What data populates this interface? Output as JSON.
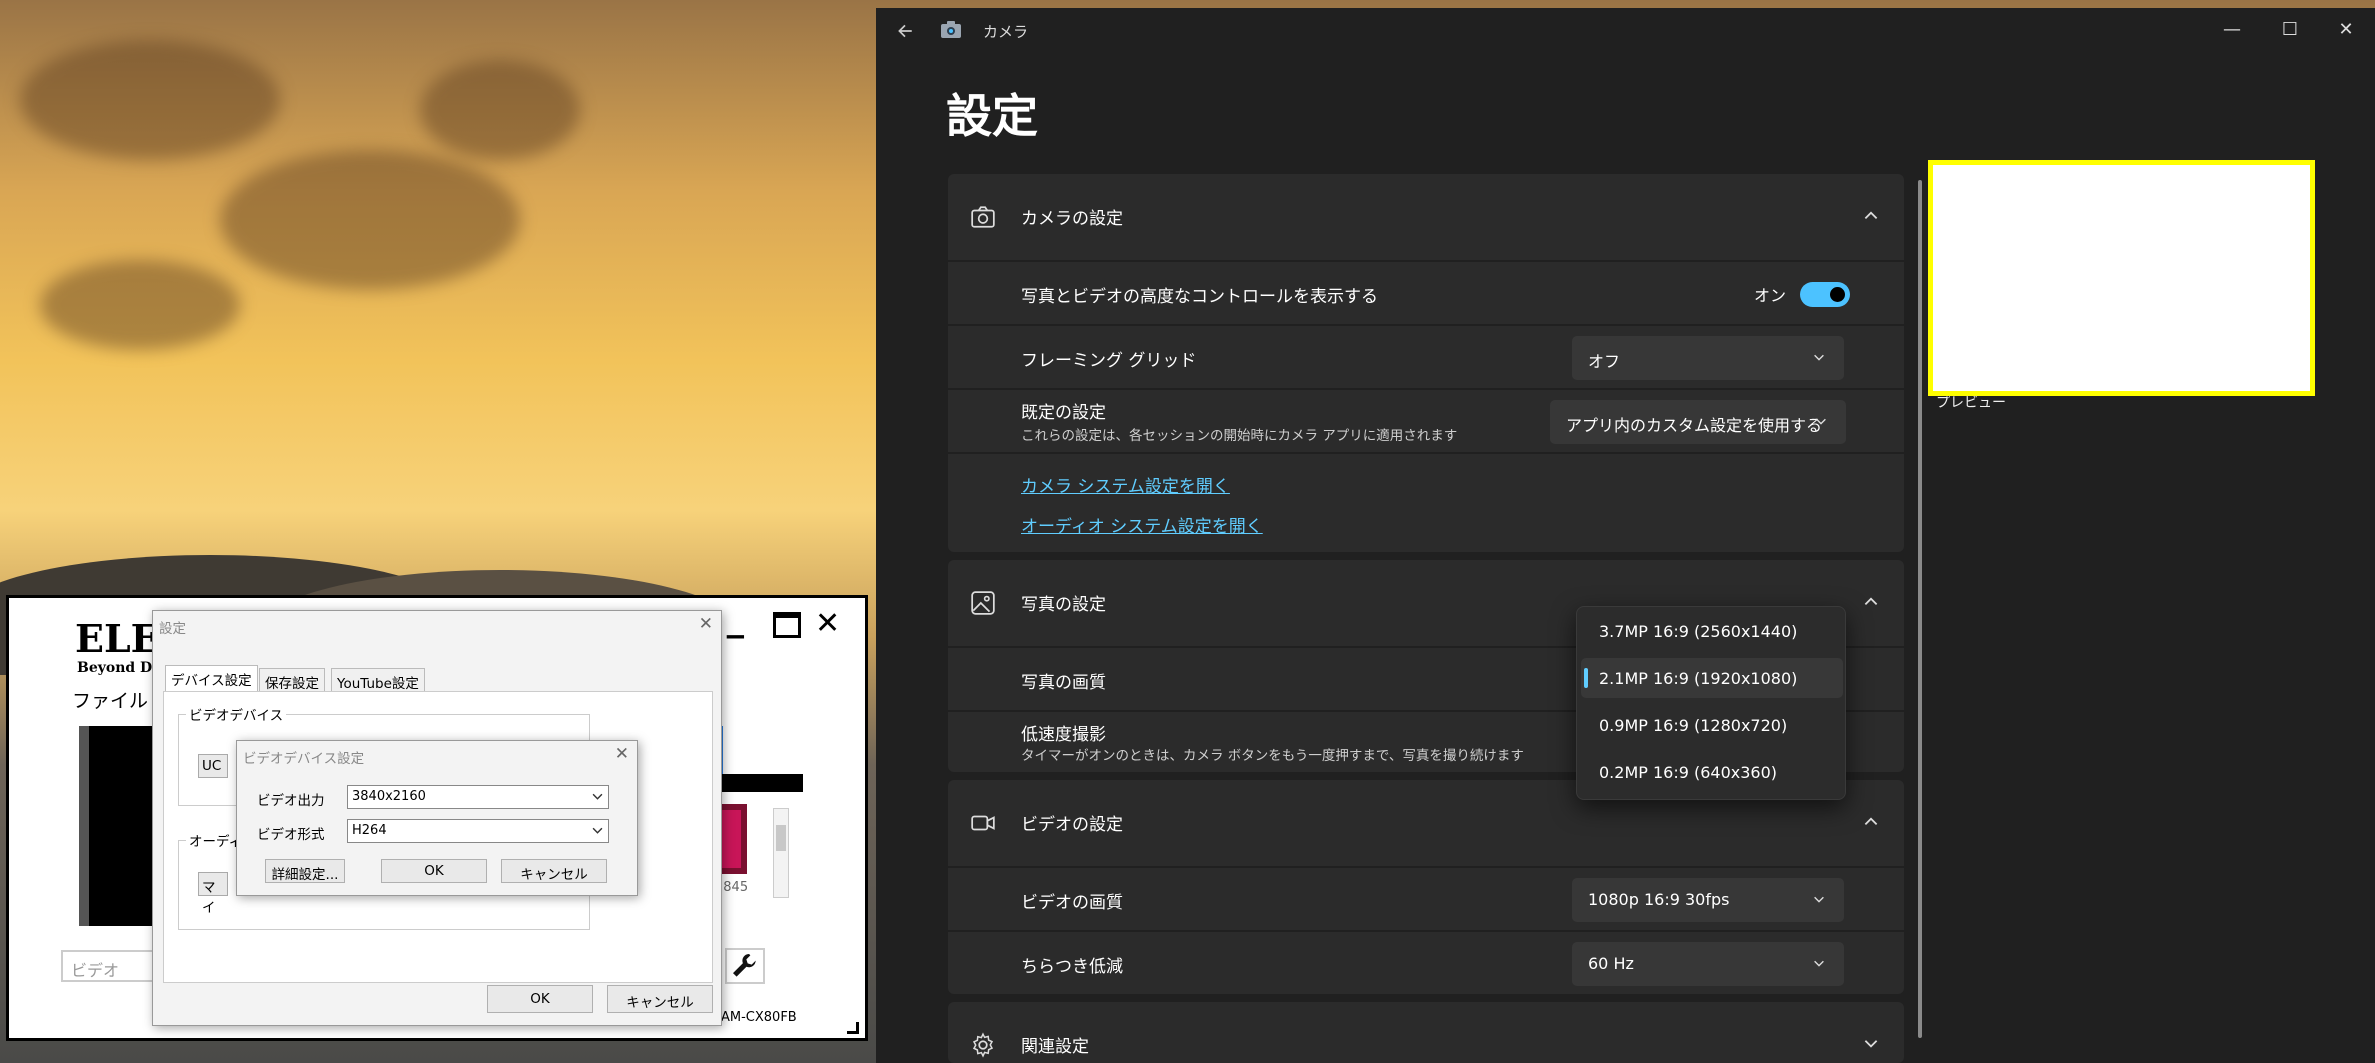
{
  "camera_app": {
    "title": "カメラ",
    "page_title": "設定",
    "camera_settings": {
      "header": "カメラの設定",
      "advanced_controls_label": "写真とビデオの高度なコントロールを表示する",
      "advanced_controls_state": "オン",
      "framing_grid_label": "フレーミング グリッド",
      "framing_grid_value": "オフ",
      "default_settings_label": "既定の設定",
      "default_settings_sub": "これらの設定は、各セッションの開始時にカメラ アプリに適用されます",
      "default_settings_value": "アプリ内のカスタム設定を使用する",
      "link_camera": "カメラ システム設定を開く",
      "link_audio": "オーディオ システム設定を開く"
    },
    "photo_settings": {
      "header": "写真の設定",
      "quality_label": "写真の画質",
      "slow_label": "低速度撮影",
      "slow_sub": "タイマーがオンのときは、カメラ ボタンをもう一度押すまで、写真を撮り続けます",
      "quality_options": [
        "3.7MP 16:9 (2560x1440)",
        "2.1MP 16:9 (1920x1080)",
        "0.9MP 16:9 (1280x720)",
        "0.2MP 16:9 (640x360)"
      ]
    },
    "video_settings": {
      "header": "ビデオの設定",
      "quality_label": "ビデオの画質",
      "quality_value": "1080p 16:9 30fps",
      "flicker_label": "ちらつき低減",
      "flicker_value": "60 Hz"
    },
    "related": {
      "header": "関連設定"
    },
    "preview_label": "プレビュー"
  },
  "elecom_app": {
    "logo": "ELE",
    "tagline": "Beyond Dig",
    "menu_file": "ファイル",
    "bottom_left_field": "ビデオ",
    "device_partial": "UC",
    "mic_partial": "マイ",
    "partial_number": "2845",
    "model_text": "AM-CX80FB"
  },
  "settings_dialog": {
    "title": "設定",
    "tabs": [
      "デバイス設定",
      "保存設定",
      "YouTube設定"
    ],
    "video_device_group": "ビデオデバイス",
    "audio_group_partial": "オーディ",
    "ok": "OK",
    "cancel": "キャンセル"
  },
  "video_device_dialog": {
    "title": "ビデオデバイス設定",
    "output_label": "ビデオ出力",
    "output_value": "3840x2160",
    "format_label": "ビデオ形式",
    "format_value": "H264",
    "advanced_button": "詳細設定...",
    "ok": "OK",
    "cancel": "キャンセル"
  },
  "colors": {
    "accent": "#4cc2ff",
    "link": "#60cdff",
    "panel": "#2b2b2b",
    "preview_border": "#ffff00"
  }
}
